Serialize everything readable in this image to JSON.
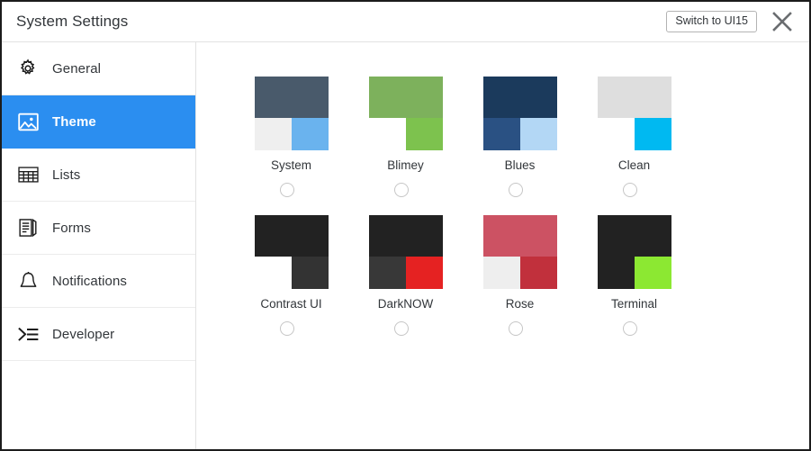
{
  "header": {
    "title": "System Settings",
    "switch_label": "Switch to UI15",
    "close_icon": "close-icon"
  },
  "sidebar": {
    "items": [
      {
        "label": "General",
        "icon": "gear-icon",
        "selected": false
      },
      {
        "label": "Theme",
        "icon": "image-icon",
        "selected": true
      },
      {
        "label": "Lists",
        "icon": "table-grid-icon",
        "selected": false
      },
      {
        "label": "Forms",
        "icon": "form-document-icon",
        "selected": false
      },
      {
        "label": "Notifications",
        "icon": "bell-icon",
        "selected": false
      },
      {
        "label": "Developer",
        "icon": "code-prompt-icon",
        "selected": false
      }
    ]
  },
  "main": {
    "themes": [
      {
        "name": "System",
        "selected": false,
        "colors": {
          "top": "#495A6B",
          "bottom_left": "#EFEFEF",
          "bottom_right": "#6AB3EE"
        }
      },
      {
        "name": "Blimey",
        "selected": false,
        "colors": {
          "top": "#7DB15C",
          "bottom_left": "#FFFFFF",
          "bottom_right": "#7DC24E"
        }
      },
      {
        "name": "Blues",
        "selected": false,
        "colors": {
          "top": "#1B3A5C",
          "bottom_left": "#2A5183",
          "bottom_right": "#B3D7F5"
        }
      },
      {
        "name": "Clean",
        "selected": false,
        "colors": {
          "top": "#DEDEDE",
          "bottom_left": "#FFFFFF",
          "bottom_right": "#00B9F1"
        }
      },
      {
        "name": "Contrast UI",
        "selected": false,
        "colors": {
          "top": "#222222",
          "bottom_left": "#FFFFFF",
          "bottom_right": "#333333"
        }
      },
      {
        "name": "DarkNOW",
        "selected": false,
        "colors": {
          "top": "#222222",
          "bottom_left": "#383838",
          "bottom_right": "#E52222"
        }
      },
      {
        "name": "Rose",
        "selected": false,
        "colors": {
          "top": "#CC5263",
          "bottom_left": "#EEEEEE",
          "bottom_right": "#C1303C"
        }
      },
      {
        "name": "Terminal",
        "selected": false,
        "colors": {
          "top": "#222222",
          "bottom_left": "#222222",
          "bottom_right": "#8CE832"
        }
      }
    ]
  },
  "colors": {
    "accent": "#2B8EF0",
    "text": "#32363A",
    "border": "#E2E2E2",
    "window_border": "#1C1C1C"
  }
}
